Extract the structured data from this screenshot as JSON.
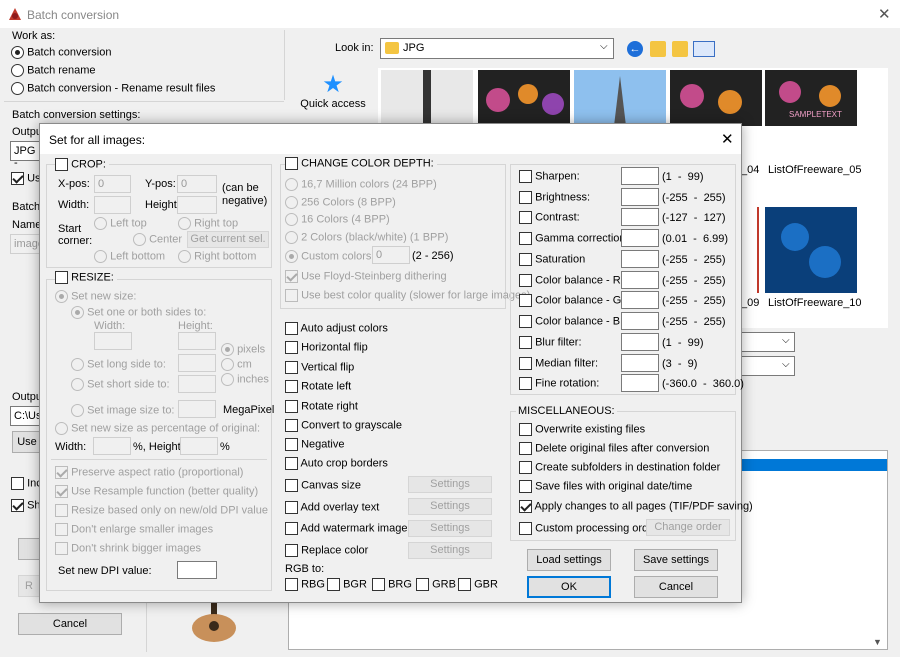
{
  "window": {
    "title": "Batch conversion"
  },
  "workas": {
    "title": "Work as:",
    "opt1": "Batch conversion",
    "opt2": "Batch rename",
    "opt3": "Batch conversion - Rename result files"
  },
  "bg": {
    "settings_title": "Batch conversion settings:",
    "output_label": "Output",
    "format_value": "JPG -",
    "use_label": "Use",
    "batch_label": "Batch",
    "name_label": "Name p",
    "name_value": "image",
    "output_label2": "Output",
    "output_path": "C:\\Use",
    "use_btn": "Use",
    "include_label": "Incl",
    "show_label": "Sho",
    "r_btn": "R",
    "cancel": "Cancel"
  },
  "lookin": {
    "label": "Look in:",
    "value": "JPG"
  },
  "quick_access": "Quick access",
  "thumbnails": {
    "t4": "_04",
    "t5": "ListOfFreeware_05",
    "t9": "_09",
    "t10": "ListOfFreeware_10",
    "sample": "SAMPLETEXT"
  },
  "dialog": {
    "title": "Set for all images:",
    "close": "✕",
    "crop": {
      "title": "CROP:",
      "xpos": "X-pos:",
      "xval": "0",
      "ypos": "Y-pos:",
      "yval": "0",
      "canbe": "(can be",
      "negative": "negative)",
      "width": "Width:",
      "height": "Height:",
      "start": "Start",
      "corner": "corner:",
      "lefttop": "Left top",
      "righttop": "Right top",
      "center": "Center",
      "getsel": "Get current sel.",
      "leftbottom": "Left bottom",
      "rightbottom": "Right bottom"
    },
    "resize": {
      "title": "RESIZE:",
      "setnew": "Set new size:",
      "setone": "Set one or both sides to:",
      "width": "Width:",
      "height": "Height:",
      "pixels": "pixels",
      "cm": "cm",
      "inches": "inches",
      "long": "Set long side to:",
      "short": "Set short side to:",
      "imgsize": "Set image size to:",
      "megapixel": "MegaPixel",
      "percent": "Set new size as percentage of original:",
      "pwidth": "Width:",
      "pheight": "%, Height:",
      "pct": "%",
      "preserve": "Preserve aspect ratio (proportional)",
      "resample": "Use Resample function (better quality)",
      "dpi_only": "Resize based only on new/old DPI value",
      "dont_enlarge": "Don't enlarge smaller images",
      "dont_shrink": "Don't shrink bigger images",
      "setdpi": "Set new DPI value:"
    },
    "depth": {
      "title": "CHANGE COLOR DEPTH:",
      "o1": "16,7 Million colors (24 BPP)",
      "o2": "256 Colors (8 BPP)",
      "o3": "16 Colors (4 BPP)",
      "o4": "2 Colors (black/white) (1 BPP)",
      "o5": "Custom colors:",
      "custom_value": "0",
      "range": "(2 - 256)",
      "floyd": "Use Floyd-Steinberg dithering",
      "best": "Use best color quality (slower for large images)"
    },
    "ops": {
      "auto_adjust": "Auto adjust colors",
      "hflip": "Horizontal flip",
      "vflip": "Vertical flip",
      "rleft": "Rotate left",
      "rright": "Rotate right",
      "gray": "Convert to grayscale",
      "negative": "Negative",
      "autocrop": "Auto crop borders",
      "canvas": "Canvas size",
      "overlay": "Add overlay text",
      "watermark": "Add watermark image",
      "replace": "Replace color",
      "settings": "Settings",
      "rgb_to": "RGB to:",
      "rbg": "RBG",
      "bgr": "BGR",
      "brg": "BRG",
      "grb": "GRB",
      "gbr": "GBR"
    },
    "adjust": {
      "sharpen": "Sharpen:",
      "sharpen_r": "(1  -  99)",
      "brightness": "Brightness:",
      "brightness_r": "(-255  -  255)",
      "contrast": "Contrast:",
      "contrast_r": "(-127  -  127)",
      "gamma": "Gamma correction:",
      "gamma_r": "(0.01  -  6.99)",
      "saturation": "Saturation",
      "saturation_r": "(-255  -  255)",
      "cbr": "Color balance - R:",
      "cbr_r": "(-255  -  255)",
      "cbg": "Color balance - G:",
      "cbg_r": "(-255  -  255)",
      "cbb": "Color balance - B:",
      "cbb_r": "(-255  -  255)",
      "blur": "Blur filter:",
      "blur_r": "(1  -  99)",
      "median": "Median filter:",
      "median_r": "(3  -  9)",
      "fine": "Fine rotation:",
      "fine_r": "(-360.0  -  360.0)"
    },
    "misc": {
      "title": "MISCELLANEOUS:",
      "overwrite": "Overwrite existing files",
      "delete": "Delete original files after conversion",
      "subfolders": "Create subfolders in destination folder",
      "savedate": "Save files with original date/time",
      "apply_all": "Apply changes to all pages (TIF/PDF saving)",
      "custom_order": "Custom processing order",
      "change_order": "Change order"
    },
    "buttons": {
      "load": "Load settings",
      "save": "Save settings",
      "ok": "OK",
      "cancel": "Cancel"
    }
  }
}
